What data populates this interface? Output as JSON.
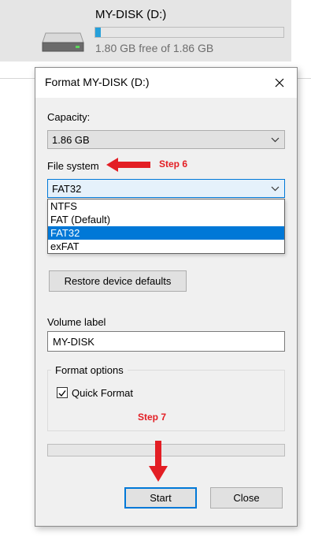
{
  "drive": {
    "name": "MY-DISK (D:)",
    "free_text": "1.80 GB free of 1.86 GB",
    "used_fraction": 0.03,
    "icon": "hard-drive-icon"
  },
  "dialog": {
    "title": "Format MY-DISK (D:)",
    "capacity_label": "Capacity:",
    "capacity_value": "1.86 GB",
    "filesystem_label": "File system",
    "filesystem_value": "FAT32",
    "filesystem_options": [
      "NTFS",
      "FAT (Default)",
      "FAT32",
      "exFAT"
    ],
    "filesystem_selected_index": 2,
    "restore_button": "Restore device defaults",
    "volume_label_label": "Volume label",
    "volume_label_value": "MY-DISK",
    "format_options_label": "Format options",
    "quick_format_label": "Quick Format",
    "quick_format_checked": true,
    "progress_fraction": 0,
    "start_button": "Start",
    "close_button": "Close"
  },
  "annotations": {
    "step6": "Step 6",
    "step7": "Step 7",
    "arrow_color": "#e31e24"
  }
}
